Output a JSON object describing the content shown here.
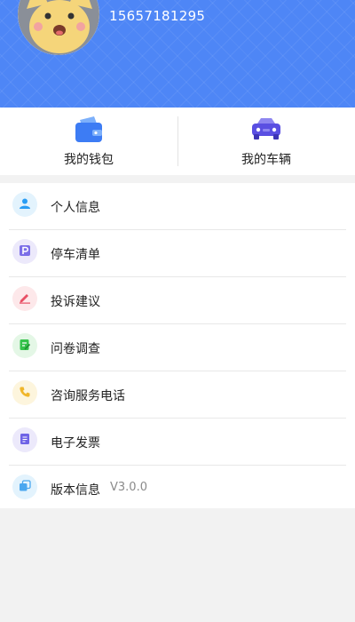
{
  "profile": {
    "phone": "15657181295"
  },
  "colors": {
    "header_bg": "#4e86f6",
    "accent": "#3d7cf4"
  },
  "quick_actions": [
    {
      "label": "我的钱包",
      "icon": "wallet-icon"
    },
    {
      "label": "我的车辆",
      "icon": "car-icon"
    }
  ],
  "menu": [
    {
      "label": "个人信息",
      "icon": "person-icon",
      "tint": "#e3f3fd",
      "color": "#2a9df4"
    },
    {
      "label": "停车清单",
      "icon": "parking-icon",
      "tint": "#ece9fb",
      "color": "#7b6ee8"
    },
    {
      "label": "投诉建议",
      "icon": "pen-icon",
      "tint": "#fde8ea",
      "color": "#e84f64"
    },
    {
      "label": "问卷调查",
      "icon": "survey-icon",
      "tint": "#e4f7e6",
      "color": "#35c24b"
    },
    {
      "label": "咨询服务电话",
      "icon": "phone-icon",
      "tint": "#fdf5dd",
      "color": "#f0b62a"
    },
    {
      "label": "电子发票",
      "icon": "invoice-icon",
      "tint": "#ece9fb",
      "color": "#6f63e6"
    },
    {
      "label": "版本信息",
      "icon": "layers-icon",
      "tint": "#e3f3fd",
      "color": "#4aa7ef",
      "extra": "V3.0.0"
    }
  ]
}
